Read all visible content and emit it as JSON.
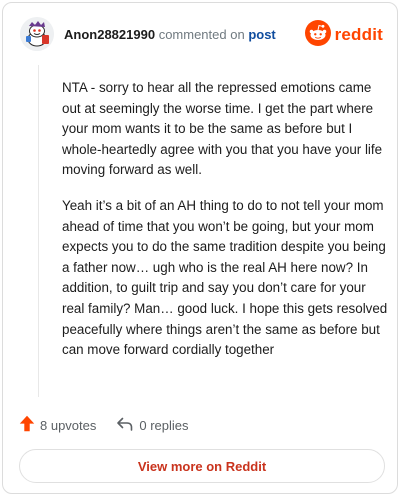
{
  "header": {
    "username": "Anon28821990",
    "commented_on": "commented on",
    "post_link": "post",
    "brand": "reddit"
  },
  "comment": {
    "paragraphs": [
      "NTA - sorry to hear all the repressed emotions came out at seemingly the worse time. I get the part where your mom wants it to be the same as before but I whole-heartedly agree with you that you have your life moving forward as well.",
      "Yeah it’s a bit of an AH thing to do to not tell your mom ahead of time that you won’t be going, but your mom expects you to do the same tradition despite you being a father now… ugh who is the real AH here now? In addition, to guilt trip and say you don’t care for your real family? Man… good luck. I hope this gets resolved peacefully where things aren’t the same as before but can move forward cordially together"
    ]
  },
  "actions": {
    "upvotes": "8 upvotes",
    "replies": "0 replies"
  },
  "footer": {
    "view_more": "View more on Reddit"
  },
  "colors": {
    "brand": "#ff4500",
    "link": "#0f4c9e",
    "view_more": "#c9331d"
  },
  "icons": {
    "avatar": "snoo-avatar-icon",
    "logo": "reddit-logo-icon",
    "upvote": "upvote-arrow-icon",
    "reply": "reply-arrow-icon"
  }
}
